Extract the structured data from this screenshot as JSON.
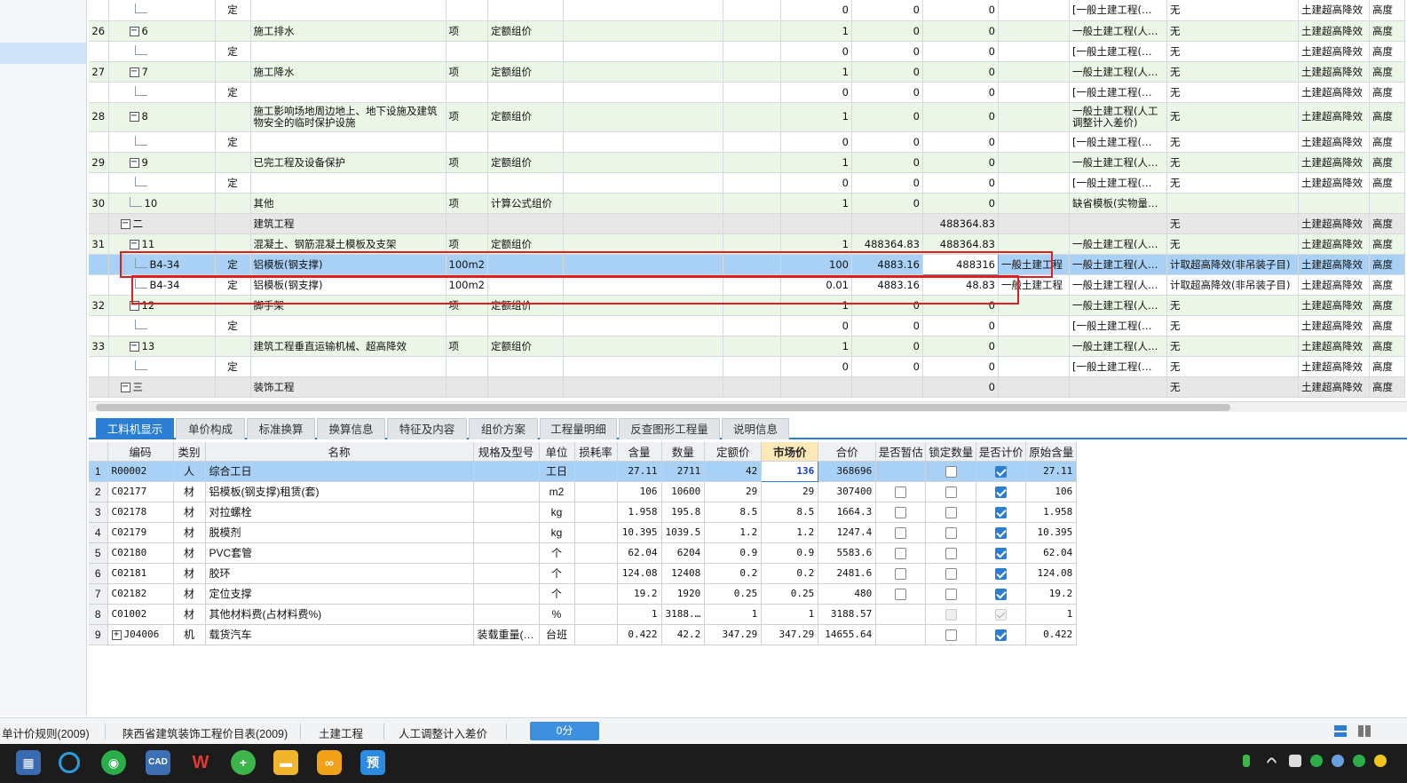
{
  "upper_rows": [
    {
      "cls": "w",
      "idx": "",
      "code": "",
      "ctype": "定",
      "name": "",
      "unit": "",
      "method": "",
      "q": "0",
      "p": "0",
      "t": "0",
      "c1": "",
      "c2": "[一般土建工程(…",
      "c3": "无",
      "c4": "土建超高降效",
      "c5": "高度",
      "lvl": 2
    },
    {
      "cls": "g",
      "idx": "26",
      "tog": "−",
      "code": "6",
      "ctype": "",
      "name": "施工排水",
      "unit": "项",
      "method": "定额组价",
      "q": "1",
      "p": "0",
      "t": "0",
      "c1": "",
      "c2": "一般土建工程(人…",
      "c3": "无",
      "c4": "土建超高降效",
      "c5": "高度",
      "lvl": 1
    },
    {
      "cls": "w",
      "idx": "",
      "code": "",
      "ctype": "定",
      "name": "",
      "unit": "",
      "method": "",
      "q": "0",
      "p": "0",
      "t": "0",
      "c1": "",
      "c2": "[一般土建工程(…",
      "c3": "无",
      "c4": "土建超高降效",
      "c5": "高度",
      "lvl": 2
    },
    {
      "cls": "g",
      "idx": "27",
      "tog": "−",
      "code": "7",
      "ctype": "",
      "name": "施工降水",
      "unit": "项",
      "method": "定额组价",
      "q": "1",
      "p": "0",
      "t": "0",
      "c1": "",
      "c2": "一般土建工程(人…",
      "c3": "无",
      "c4": "土建超高降效",
      "c5": "高度",
      "lvl": 1
    },
    {
      "cls": "w",
      "idx": "",
      "code": "",
      "ctype": "定",
      "name": "",
      "unit": "",
      "method": "",
      "q": "0",
      "p": "0",
      "t": "0",
      "c1": "",
      "c2": "[一般土建工程(…",
      "c3": "无",
      "c4": "土建超高降效",
      "c5": "高度",
      "lvl": 2
    },
    {
      "cls": "g tall",
      "idx": "28",
      "tog": "−",
      "code": "8",
      "ctype": "",
      "name": "施工影响场地周边地上、地下设施及建筑物安全的临时保护设施",
      "unit": "项",
      "method": "定额组价",
      "q": "1",
      "p": "0",
      "t": "0",
      "c1": "",
      "c2": "一般土建工程(人工调整计入差价)",
      "c3": "无",
      "c4": "土建超高降效",
      "c5": "高度",
      "lvl": 1
    },
    {
      "cls": "w",
      "idx": "",
      "code": "",
      "ctype": "定",
      "name": "",
      "unit": "",
      "method": "",
      "q": "0",
      "p": "0",
      "t": "0",
      "c1": "",
      "c2": "[一般土建工程(…",
      "c3": "无",
      "c4": "土建超高降效",
      "c5": "高度",
      "lvl": 2
    },
    {
      "cls": "g",
      "idx": "29",
      "tog": "−",
      "code": "9",
      "ctype": "",
      "name": "已完工程及设备保护",
      "unit": "项",
      "method": "定额组价",
      "q": "1",
      "p": "0",
      "t": "0",
      "c1": "",
      "c2": "一般土建工程(人…",
      "c3": "无",
      "c4": "土建超高降效",
      "c5": "高度",
      "lvl": 1
    },
    {
      "cls": "w",
      "idx": "",
      "code": "",
      "ctype": "定",
      "name": "",
      "unit": "",
      "method": "",
      "q": "0",
      "p": "0",
      "t": "0",
      "c1": "",
      "c2": "[一般土建工程(…",
      "c3": "无",
      "c4": "土建超高降效",
      "c5": "高度",
      "lvl": 2
    },
    {
      "cls": "g",
      "idx": "30",
      "code": "10",
      "ctype": "",
      "name": "其他",
      "unit": "项",
      "method": "计算公式组价",
      "q": "1",
      "p": "0",
      "t": "0",
      "c1": "",
      "c2": "缺省模板(实物量…",
      "c3": "",
      "c4": "",
      "c5": "",
      "lvl": 1
    },
    {
      "cls": "grey",
      "idx": "",
      "tog": "−",
      "code": "二",
      "ctype": "",
      "name": "建筑工程",
      "unit": "",
      "method": "",
      "q": "",
      "p": "",
      "t": "488364.83",
      "c1": "",
      "c2": "",
      "c3": "无",
      "c4": "土建超高降效",
      "c5": "高度",
      "lvl": 0
    },
    {
      "cls": "g",
      "idx": "31",
      "tog": "−",
      "code": "11",
      "ctype": "",
      "name": "混凝土、钢筋混凝土模板及支架",
      "unit": "项",
      "method": "定额组价",
      "q": "1",
      "p": "488364.83",
      "t": "488364.83",
      "c1": "",
      "c2": "一般土建工程(人…",
      "c3": "无",
      "c4": "土建超高降效",
      "c5": "高度",
      "lvl": 1
    },
    {
      "cls": "sel",
      "idx": "",
      "code": "B4-34",
      "ctype": "定",
      "name": "铝模板(钢支撑)",
      "unit": "100m2",
      "method": "",
      "q": "100",
      "p": "4883.16",
      "t": "488316",
      "c1": "一般土建工程",
      "c2": "一般土建工程(人…",
      "c3": "计取超高降效(非吊装子目)",
      "c4": "土建超高降效",
      "c5": "高度",
      "lvl": 2,
      "edit": true
    },
    {
      "cls": "w",
      "idx": "",
      "code": "B4-34",
      "ctype": "定",
      "name": "铝模板(钢支撑)",
      "unit": "100m2",
      "method": "",
      "q": "0.01",
      "p": "4883.16",
      "t": "48.83",
      "c1": "一般土建工程",
      "c2": "一般土建工程(人…",
      "c3": "计取超高降效(非吊装子目)",
      "c4": "土建超高降效",
      "c5": "高度",
      "lvl": 2
    },
    {
      "cls": "g",
      "idx": "32",
      "tog": "−",
      "code": "12",
      "ctype": "",
      "name": "脚手架",
      "unit": "项",
      "method": "定额组价",
      "q": "1",
      "p": "0",
      "t": "0",
      "c1": "",
      "c2": "一般土建工程(人…",
      "c3": "无",
      "c4": "土建超高降效",
      "c5": "高度",
      "lvl": 1
    },
    {
      "cls": "w",
      "idx": "",
      "code": "",
      "ctype": "定",
      "name": "",
      "unit": "",
      "method": "",
      "q": "0",
      "p": "0",
      "t": "0",
      "c1": "",
      "c2": "[一般土建工程(…",
      "c3": "无",
      "c4": "土建超高降效",
      "c5": "高度",
      "lvl": 2
    },
    {
      "cls": "g",
      "idx": "33",
      "tog": "−",
      "code": "13",
      "ctype": "",
      "name": "建筑工程垂直运输机械、超高降效",
      "unit": "项",
      "method": "定额组价",
      "q": "1",
      "p": "0",
      "t": "0",
      "c1": "",
      "c2": "一般土建工程(人…",
      "c3": "无",
      "c4": "土建超高降效",
      "c5": "高度",
      "lvl": 1
    },
    {
      "cls": "w",
      "idx": "",
      "code": "",
      "ctype": "定",
      "name": "",
      "unit": "",
      "method": "",
      "q": "0",
      "p": "0",
      "t": "0",
      "c1": "",
      "c2": "[一般土建工程(…",
      "c3": "无",
      "c4": "土建超高降效",
      "c5": "高度",
      "lvl": 2
    },
    {
      "cls": "grey",
      "idx": "",
      "tog": "−",
      "code": "三",
      "ctype": "",
      "name": "装饰工程",
      "unit": "",
      "method": "",
      "q": "",
      "p": "",
      "t": "0",
      "c1": "",
      "c2": "",
      "c3": "无",
      "c4": "土建超高降效",
      "c5": "高度",
      "lvl": 0
    }
  ],
  "tabs": [
    "工料机显示",
    "单价构成",
    "标准换算",
    "换算信息",
    "特征及内容",
    "组价方案",
    "工程量明细",
    "反查图形工程量",
    "说明信息"
  ],
  "lower_headers": [
    "编码",
    "类别",
    "名称",
    "规格及型号",
    "单位",
    "损耗率",
    "含量",
    "数量",
    "定额价",
    "市场价",
    "合价",
    "是否暂估",
    "锁定数量",
    "是否计价",
    "原始含量"
  ],
  "lower_rows": [
    {
      "rn": "1",
      "code": "R00002",
      "type": "人",
      "name": "综合工日",
      "spec": "",
      "unit": "工日",
      "loss": "",
      "qty": "27.11",
      "num": "2711",
      "qp": "42",
      "mp": "136",
      "sum": "368696",
      "est": "none",
      "lock": "off",
      "price": "on",
      "orig": "27.11",
      "sel": true
    },
    {
      "rn": "2",
      "code": "C02177",
      "type": "材",
      "name": "铝模板(钢支撑)租赁(套)",
      "spec": "",
      "unit": "m2",
      "loss": "",
      "qty": "106",
      "num": "10600",
      "qp": "29",
      "mp": "29",
      "sum": "307400",
      "est": "off",
      "lock": "off",
      "price": "on",
      "orig": "106"
    },
    {
      "rn": "3",
      "code": "C02178",
      "type": "材",
      "name": "对拉螺栓",
      "spec": "",
      "unit": "kg",
      "loss": "",
      "qty": "1.958",
      "num": "195.8",
      "qp": "8.5",
      "mp": "8.5",
      "sum": "1664.3",
      "est": "off",
      "lock": "off",
      "price": "on",
      "orig": "1.958"
    },
    {
      "rn": "4",
      "code": "C02179",
      "type": "材",
      "name": "脱模剂",
      "spec": "",
      "unit": "kg",
      "loss": "",
      "qty": "10.395",
      "num": "1039.5",
      "qp": "1.2",
      "mp": "1.2",
      "sum": "1247.4",
      "est": "off",
      "lock": "off",
      "price": "on",
      "orig": "10.395"
    },
    {
      "rn": "5",
      "code": "C02180",
      "type": "材",
      "name": "PVC套管",
      "spec": "",
      "unit": "个",
      "loss": "",
      "qty": "62.04",
      "num": "6204",
      "qp": "0.9",
      "mp": "0.9",
      "sum": "5583.6",
      "est": "off",
      "lock": "off",
      "price": "on",
      "orig": "62.04"
    },
    {
      "rn": "6",
      "code": "C02181",
      "type": "材",
      "name": "胶环",
      "spec": "",
      "unit": "个",
      "loss": "",
      "qty": "124.08",
      "num": "12408",
      "qp": "0.2",
      "mp": "0.2",
      "sum": "2481.6",
      "est": "off",
      "lock": "off",
      "price": "on",
      "orig": "124.08"
    },
    {
      "rn": "7",
      "code": "C02182",
      "type": "材",
      "name": "定位支撑",
      "spec": "",
      "unit": "个",
      "loss": "",
      "qty": "19.2",
      "num": "1920",
      "qp": "0.25",
      "mp": "0.25",
      "sum": "480",
      "est": "off",
      "lock": "off",
      "price": "on",
      "orig": "19.2"
    },
    {
      "rn": "8",
      "code": "C01002",
      "type": "材",
      "name": "其他材料费(占材料费%)",
      "spec": "",
      "unit": "%",
      "loss": "",
      "qty": "1",
      "num": "3188.…",
      "qp": "1",
      "mp": "1",
      "sum": "3188.57",
      "est": "none",
      "lock": "dis",
      "price": "dison",
      "orig": "1"
    },
    {
      "rn": "9",
      "code": "J04006",
      "type": "机",
      "name": "载货汽车",
      "spec": "装载重量(…",
      "unit": "台班",
      "loss": "",
      "qty": "0.422",
      "num": "42.2",
      "qp": "347.29",
      "mp": "347.29",
      "sum": "14655.64",
      "est": "none",
      "lock": "off",
      "price": "on",
      "orig": "0.422",
      "plus": true
    }
  ],
  "status": {
    "rule": "单计价规则(2009)",
    "table": "陕西省建筑装饰工程价目表(2009)",
    "discipline": "土建工程",
    "mode": "人工调整计入差价",
    "score": "0分"
  },
  "taskbar": {
    "cad_label": "CAD",
    "yu_label": "预"
  },
  "colors": {
    "accent": "#2a7fd4",
    "highlight_box": "#e02020",
    "selected_row": "#a9d1f5"
  }
}
